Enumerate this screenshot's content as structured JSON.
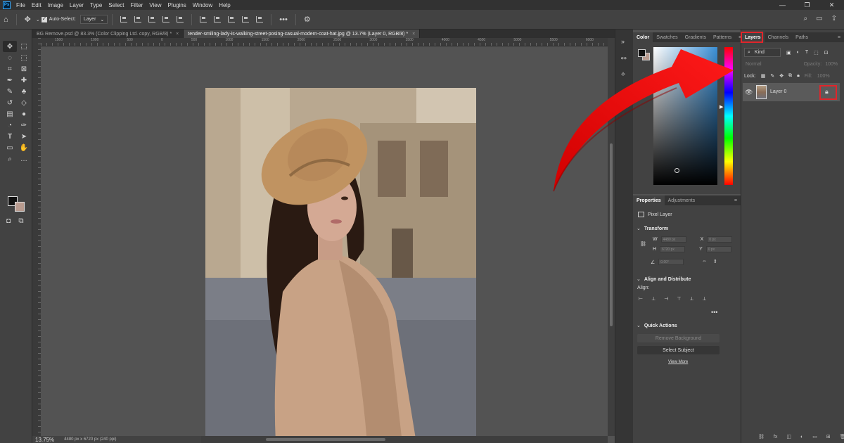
{
  "app": {
    "logo": "Ps"
  },
  "menu": [
    "File",
    "Edit",
    "Image",
    "Layer",
    "Type",
    "Select",
    "Filter",
    "View",
    "Plugins",
    "Window",
    "Help"
  ],
  "window_controls": [
    "—",
    "❐",
    "✕"
  ],
  "options_bar": {
    "auto_select_label": "Auto-Select:",
    "auto_select_value": "Layer",
    "more": "•••"
  },
  "tabs": [
    {
      "label": "BG Remove.psd @ 83.3% (Color Clipping Ltd. copy, RGB/8) *",
      "close": "×"
    },
    {
      "label": "tender-smiling-lady-is-walking-street-posing-casual-modern-coat-hat.jpg @ 13.7% (Layer 0, RGB/8) *",
      "close": "×"
    }
  ],
  "ruler_labels": [
    "1500",
    "1000",
    "500",
    "0",
    "500",
    "1000",
    "1500",
    "2000",
    "2500",
    "3000",
    "3500",
    "4000",
    "4500",
    "5000",
    "5500",
    "6000"
  ],
  "status": {
    "zoom": "13.75%",
    "dimensions": "4480 px x 6720 px (240 ppi)"
  },
  "color_panel": {
    "tabs": [
      "Color",
      "Swatches",
      "Gradients",
      "Patterns"
    ]
  },
  "properties_panel": {
    "tabs": [
      "Properties",
      "Adjustments"
    ],
    "pixel_layer": "Pixel Layer",
    "transform_title": "Transform",
    "w_label": "W",
    "h_label": "H",
    "x_label": "X",
    "y_label": "Y",
    "w_value": "4480 px",
    "h_value": "6720 px",
    "x_value": "0 px",
    "y_value": "0 px",
    "angle_value": "0.00°",
    "align_title": "Align and Distribute",
    "align_label": "Align:",
    "quick_actions_title": "Quick Actions",
    "remove_bg": "Remove Background",
    "select_subject": "Select Subject",
    "view_more": "View More"
  },
  "layers_panel": {
    "tabs": [
      "Layers",
      "Channels",
      "Paths"
    ],
    "filter_kind": "Kind",
    "blend_mode": "Normal",
    "opacity_label": "Opacity:",
    "opacity_value": "100%",
    "lock_label": "Lock:",
    "fill_label": "Fill:",
    "fill_value": "100%",
    "layer_name": "Layer 0"
  },
  "colors": {
    "highlight_red": "#e0252b",
    "arrow_red": "#ff0000",
    "accent_blue": "#31a8ff"
  }
}
